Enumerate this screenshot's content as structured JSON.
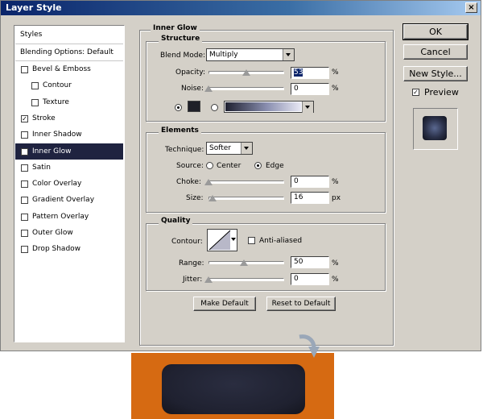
{
  "window": {
    "title": "Layer Style",
    "close_glyph": "×"
  },
  "styles_panel": {
    "header": "Styles",
    "blending": "Blending Options: Default",
    "items": [
      {
        "label": "Bevel & Emboss",
        "checked": false,
        "indent": false
      },
      {
        "label": "Contour",
        "checked": false,
        "indent": true
      },
      {
        "label": "Texture",
        "checked": false,
        "indent": true
      },
      {
        "label": "Stroke",
        "checked": true,
        "indent": false
      },
      {
        "label": "Inner Shadow",
        "checked": false,
        "indent": false
      },
      {
        "label": "Inner Glow",
        "checked": true,
        "indent": false,
        "selected": true
      },
      {
        "label": "Satin",
        "checked": false,
        "indent": false
      },
      {
        "label": "Color Overlay",
        "checked": false,
        "indent": false
      },
      {
        "label": "Gradient Overlay",
        "checked": false,
        "indent": false
      },
      {
        "label": "Pattern Overlay",
        "checked": false,
        "indent": false
      },
      {
        "label": "Outer Glow",
        "checked": false,
        "indent": false
      },
      {
        "label": "Drop Shadow",
        "checked": false,
        "indent": false
      }
    ]
  },
  "inner_glow": {
    "title": "Inner Glow",
    "structure": {
      "title": "Structure",
      "blend_mode_label": "Blend Mode:",
      "blend_mode_value": "Multiply",
      "opacity_label": "Opacity:",
      "opacity_value": "53",
      "opacity_percent": 53,
      "noise_label": "Noise:",
      "noise_value": "0",
      "noise_percent": 0,
      "unit_percent": "%",
      "color_swatch": "#1f2028"
    },
    "elements": {
      "title": "Elements",
      "technique_label": "Technique:",
      "technique_value": "Softer",
      "source_label": "Source:",
      "source_center": "Center",
      "source_edge": "Edge",
      "source_selected": "Edge",
      "choke_label": "Choke:",
      "choke_value": "0",
      "choke_percent": 0,
      "size_label": "Size:",
      "size_value": "16",
      "size_percent": 6,
      "unit_px": "px"
    },
    "quality": {
      "title": "Quality",
      "contour_label": "Contour:",
      "anti_aliased_label": "Anti-aliased",
      "anti_aliased_checked": false,
      "range_label": "Range:",
      "range_value": "50",
      "range_percent": 50,
      "jitter_label": "Jitter:",
      "jitter_value": "0",
      "jitter_percent": 0
    },
    "make_default": "Make Default",
    "reset_default": "Reset to Default"
  },
  "right": {
    "ok": "OK",
    "cancel": "Cancel",
    "new_style": "New Style...",
    "preview_label": "Preview",
    "preview_checked": true
  },
  "colors": {
    "accent_orange": "#d66a12",
    "dark_shape": "#1f2130",
    "selected_row": "#1f2340"
  }
}
